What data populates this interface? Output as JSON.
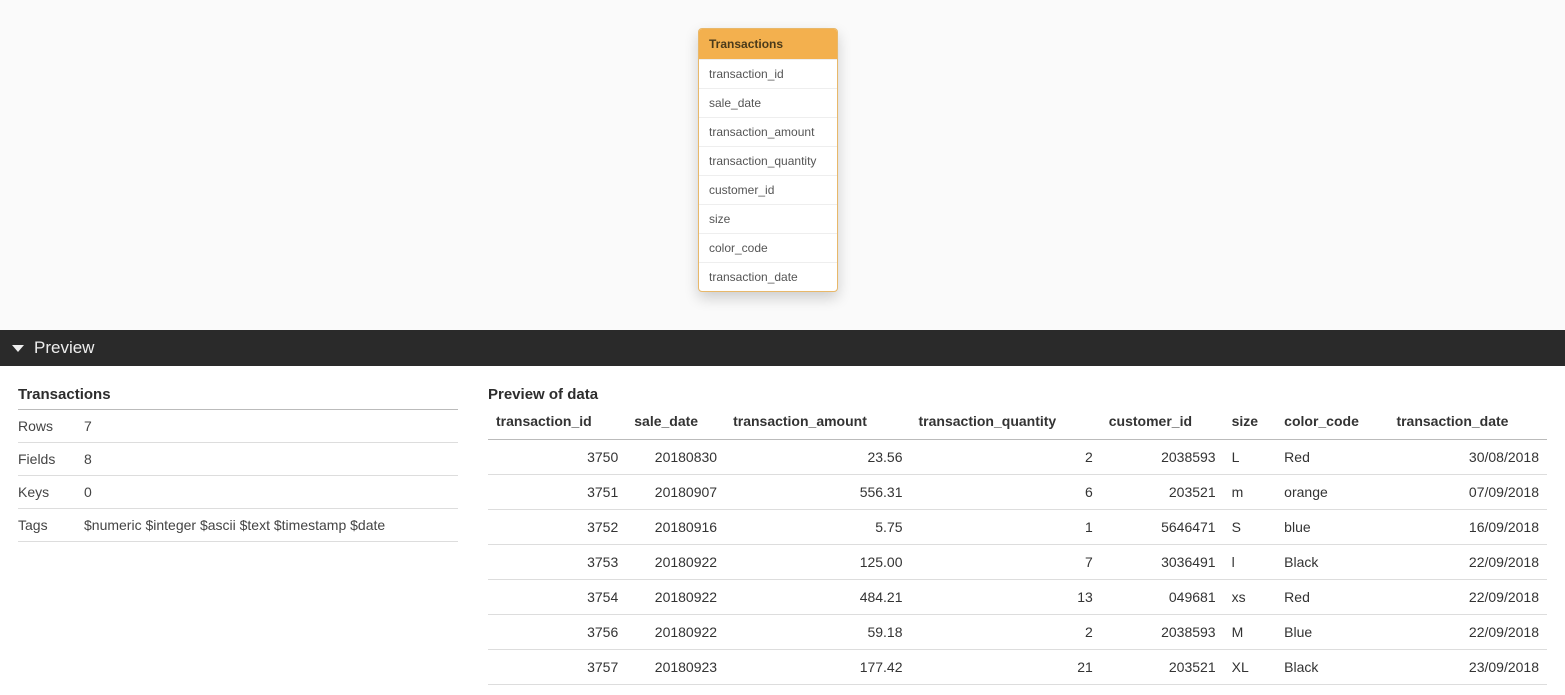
{
  "card": {
    "title": "Transactions",
    "fields": [
      "transaction_id",
      "sale_date",
      "transaction_amount",
      "transaction_quantity",
      "customer_id",
      "size",
      "color_code",
      "transaction_date"
    ]
  },
  "preview": {
    "bar_label": "Preview",
    "meta": {
      "title": "Transactions",
      "rows_label": "Rows",
      "rows_value": "7",
      "fields_label": "Fields",
      "fields_value": "8",
      "keys_label": "Keys",
      "keys_value": "0",
      "tags_label": "Tags",
      "tags_value": "$numeric $integer $ascii $text $timestamp $date"
    },
    "data_title": "Preview of data",
    "columns": [
      "transaction_id",
      "sale_date",
      "transaction_amount",
      "transaction_quantity",
      "customer_id",
      "size",
      "color_code",
      "transaction_date"
    ],
    "numeric_cols": [
      0,
      1,
      2,
      3,
      4,
      7
    ],
    "rows": [
      [
        "3750",
        "20180830",
        "23.56",
        "2",
        "2038593",
        "L",
        "Red",
        "30/08/2018"
      ],
      [
        "3751",
        "20180907",
        "556.31",
        "6",
        "203521",
        "m",
        "orange",
        "07/09/2018"
      ],
      [
        "3752",
        "20180916",
        "5.75",
        "1",
        "5646471",
        "S",
        "blue",
        "16/09/2018"
      ],
      [
        "3753",
        "20180922",
        "125.00",
        "7",
        "3036491",
        "l",
        "Black",
        "22/09/2018"
      ],
      [
        "3754",
        "20180922",
        "484.21",
        "13",
        "049681",
        "xs",
        "Red",
        "22/09/2018"
      ],
      [
        "3756",
        "20180922",
        "59.18",
        "2",
        "2038593",
        "M",
        "Blue",
        "22/09/2018"
      ],
      [
        "3757",
        "20180923",
        "177.42",
        "21",
        "203521",
        "XL",
        "Black",
        "23/09/2018"
      ]
    ]
  }
}
